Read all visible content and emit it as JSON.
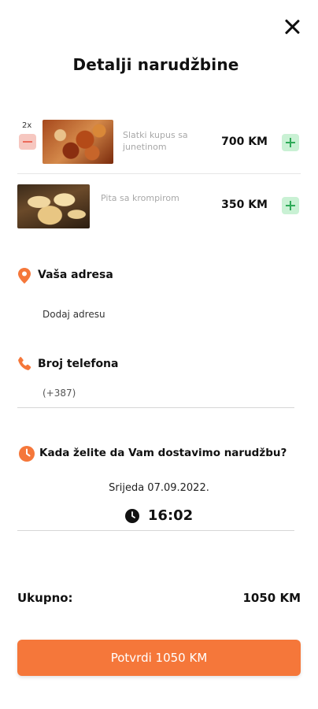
{
  "header": {
    "title": "Detalji narudžbine",
    "close_icon": "close-icon"
  },
  "order": {
    "items": [
      {
        "quantity": "2x",
        "name": "Slatki kupus sa junetinom",
        "price": "700 KM"
      },
      {
        "quantity": "",
        "name": "Pita sa krompirom",
        "price": "350 KM"
      }
    ]
  },
  "address": {
    "label": "Vaša adresa",
    "value": "Dodaj adresu",
    "icon": "location-pin-icon"
  },
  "phone": {
    "label": "Broj telefona",
    "placeholder": "(+387)",
    "icon": "phone-icon"
  },
  "delivery": {
    "question": "Kada želite da Vam dostavimo narudžbu?",
    "date": "Srijeda 07.09.2022.",
    "time": "16:02",
    "icon": "clock-icon"
  },
  "total": {
    "label": "Ukupno:",
    "value": "1050 KM"
  },
  "confirm_button": {
    "label": "Potvrdi 1050 KM"
  },
  "colors": {
    "accent": "#f5773a",
    "plus_bg": "#c9f1d4",
    "plus_fg": "#2faa58",
    "minus_bg": "#f6c7c0",
    "minus_fg": "#ec6a5a"
  }
}
